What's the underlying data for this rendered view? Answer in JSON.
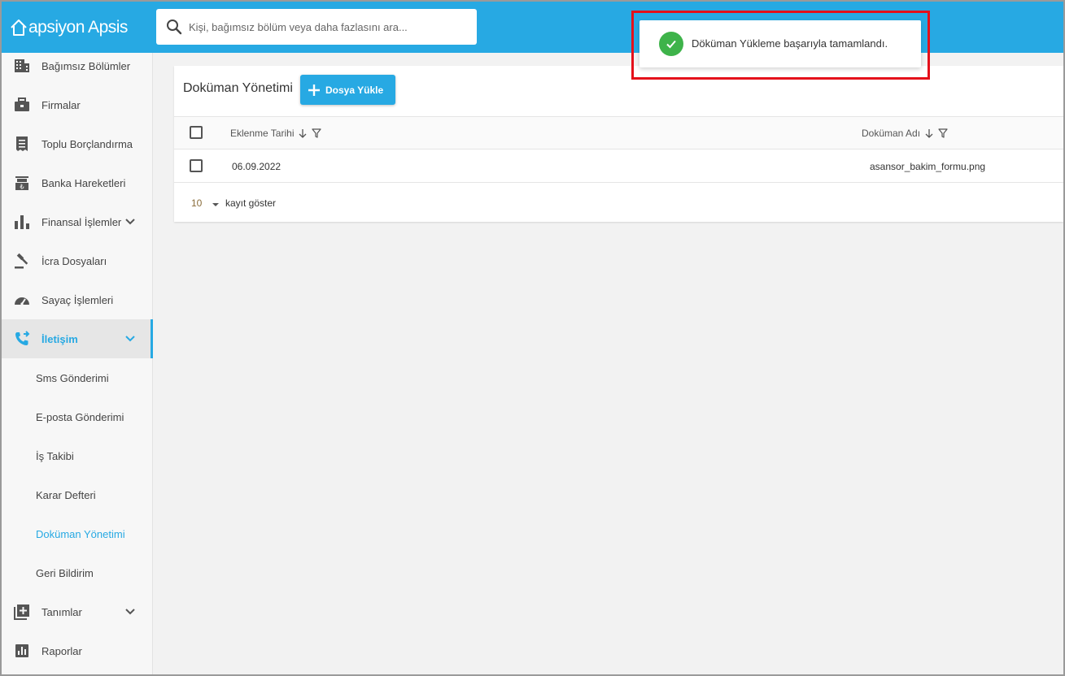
{
  "brand": {
    "logo_text": "apsiyon Apsis"
  },
  "search": {
    "placeholder": "Kişi, bağımsız bölüm veya daha fazlasını ara..."
  },
  "sidebar": {
    "items": [
      {
        "label": "Bağımsız Bölümler",
        "icon": "building-icon"
      },
      {
        "label": "Firmalar",
        "icon": "briefcase-icon"
      },
      {
        "label": "Toplu Borçlandırma",
        "icon": "receipt-icon"
      },
      {
        "label": "Banka Hareketleri",
        "icon": "bank-icon"
      },
      {
        "label": "Finansal İşlemler",
        "icon": "bar-chart-icon"
      },
      {
        "label": "İcra Dosyaları",
        "icon": "gavel-icon"
      },
      {
        "label": "Sayaç İşlemleri",
        "icon": "gauge-icon"
      },
      {
        "label": "İletişim",
        "icon": "phone-forward-icon"
      },
      {
        "label": "Tanımlar",
        "icon": "add-box-icon"
      },
      {
        "label": "Raporlar",
        "icon": "report-icon"
      }
    ],
    "subitems": [
      {
        "label": "Sms Gönderimi"
      },
      {
        "label": "E-posta Gönderimi"
      },
      {
        "label": "İş Takibi"
      },
      {
        "label": "Karar Defteri"
      },
      {
        "label": "Doküman Yönetimi"
      },
      {
        "label": "Geri Bildirim"
      }
    ]
  },
  "main": {
    "title": "Doküman Yönetimi",
    "upload_label": "Dosya Yükle",
    "columns": [
      "Eklenme Tarihi",
      "Doküman Adı"
    ],
    "rows": [
      {
        "date": "06.09.2022",
        "name": "asansor_bakim_formu.png"
      }
    ],
    "pager": {
      "page_size": "10",
      "label": "kayıt göster"
    }
  },
  "toast": {
    "message": "Döküman Yükleme başarıyla tamamlandı."
  },
  "colors": {
    "accent": "#27a9e3",
    "success": "#3eb34a",
    "highlight": "#e4101a"
  }
}
